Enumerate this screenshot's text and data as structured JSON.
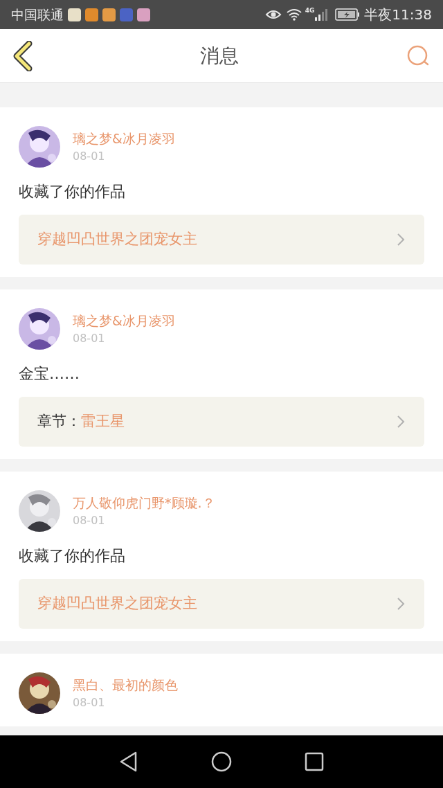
{
  "status_bar": {
    "carrier": "中国联通",
    "network": "4G",
    "time": "半夜11:38"
  },
  "header": {
    "title": "消息"
  },
  "messages": [
    {
      "user": "璃之梦&冰月凌羽",
      "date": "08-01",
      "text": "收藏了你的作品",
      "link": {
        "kind": "work",
        "title": "穿越凹凸世界之团宠女主"
      }
    },
    {
      "user": "璃之梦&冰月凌羽",
      "date": "08-01",
      "text": "金宝……",
      "link": {
        "kind": "chapter",
        "label": "章节：",
        "title": "雷王星"
      }
    },
    {
      "user": "万人敬仰虎门野*顾璇.？",
      "date": "08-01",
      "text": "收藏了你的作品",
      "link": {
        "kind": "work",
        "title": "穿越凹凸世界之团宠女主"
      }
    },
    {
      "user": "黑白、最初的颜色",
      "date": "08-01"
    }
  ]
}
